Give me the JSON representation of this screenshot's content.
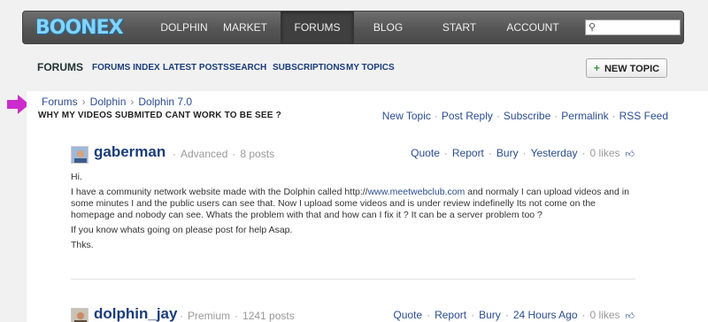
{
  "nav": {
    "logo": "BOONEX",
    "items": [
      "DOLPHIN",
      "MARKET",
      "FORUMS",
      "BLOG",
      "START",
      "ACCOUNT"
    ],
    "active": "FORUMS",
    "search_value": ""
  },
  "subnav": {
    "title": "FORUMS",
    "links": [
      "FORUMS INDEX",
      "LATEST POSTS",
      "SEARCH",
      "SUBSCRIPTIONS",
      "MY TOPICS"
    ],
    "new_topic": "NEW TOPIC"
  },
  "breadcrumb": [
    "Forums",
    "Dolphin",
    "Dolphin 7.0"
  ],
  "thread": {
    "title": "WHY MY VIDEOS SUBMITED CANT WORK TO BE SEE ?",
    "actions": [
      "New Topic",
      "Post Reply",
      "Subscribe",
      "Permalink",
      "RSS Feed"
    ]
  },
  "posts": [
    {
      "author": "gaberman",
      "level": "Advanced",
      "post_count": "8 posts",
      "actions": [
        "Quote",
        "Report",
        "Bury",
        "Yesterday"
      ],
      "likes": "0 likes",
      "greeting": "Hi.",
      "body_pre": "I have a community network website made with the Dolphin called http://",
      "body_link": "www.meetwebclub.com",
      "body_post": " and normaly I can upload videos and in some minutes I and the public users can see that. Now I upload some videos and is under review indefinelly Its not come on the homepage and nobody can see. Whats the problem with that and how can I fix it ? It can be a server problem too ?",
      "line2": "If you know whats going on please post for help Asap.",
      "line3": "Thks."
    },
    {
      "author": "dolphin_jay",
      "level": "Premium",
      "post_count": "1241 posts",
      "actions": [
        "Quote",
        "Report",
        "Bury",
        "24 Hours Ago"
      ],
      "likes": "0 likes"
    }
  ],
  "colors": {
    "link": "#2a4d8f",
    "nav_bg": "#555555",
    "accent_arrow": "#cc2ccc"
  }
}
